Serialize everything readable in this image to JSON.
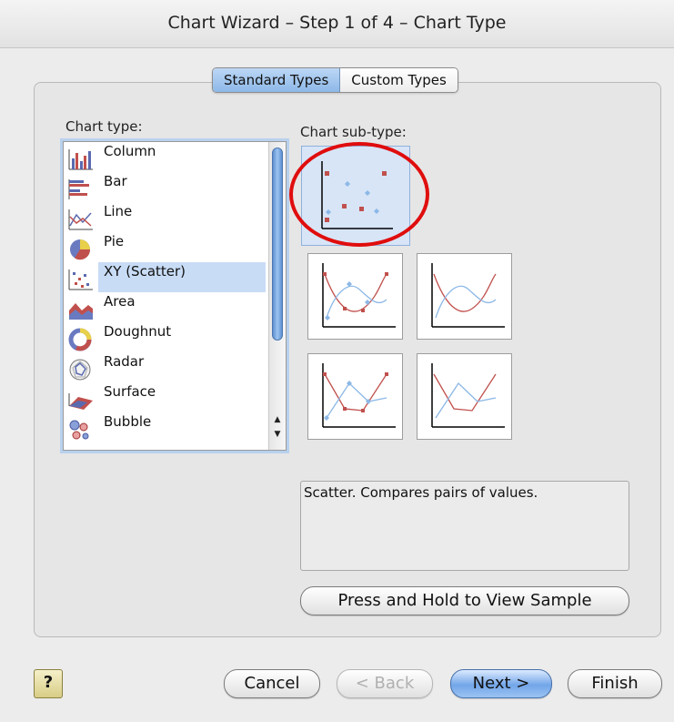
{
  "window": {
    "title": "Chart Wizard – Step 1 of 4 – Chart Type"
  },
  "tabs": [
    {
      "label": "Standard Types",
      "active": true
    },
    {
      "label": "Custom Types",
      "active": false
    }
  ],
  "chart_type": {
    "label": "Chart type:",
    "selected": "XY (Scatter)",
    "items": [
      {
        "label": "Column",
        "icon": "column-chart-icon"
      },
      {
        "label": "Bar",
        "icon": "bar-chart-icon"
      },
      {
        "label": "Line",
        "icon": "line-chart-icon"
      },
      {
        "label": "Pie",
        "icon": "pie-chart-icon"
      },
      {
        "label": "XY (Scatter)",
        "icon": "scatter-chart-icon"
      },
      {
        "label": "Area",
        "icon": "area-chart-icon"
      },
      {
        "label": "Doughnut",
        "icon": "doughnut-chart-icon"
      },
      {
        "label": "Radar",
        "icon": "radar-chart-icon"
      },
      {
        "label": "Surface",
        "icon": "surface-chart-icon"
      },
      {
        "label": "Bubble",
        "icon": "bubble-chart-icon"
      }
    ]
  },
  "chart_subtype": {
    "label": "Chart sub-type:",
    "selected_index": 0,
    "description": "Scatter. Compares pairs of values."
  },
  "buttons": {
    "sample": "Press and Hold to View Sample",
    "help": "?",
    "cancel": "Cancel",
    "back": "< Back",
    "next": "Next >",
    "finish": "Finish"
  },
  "colors": {
    "accent": "#8db8e8",
    "highlight": "#e00d0d",
    "series_red": "#c0504d",
    "series_blue": "#8cb8e6"
  }
}
